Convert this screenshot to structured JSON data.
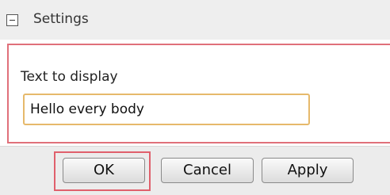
{
  "header": {
    "title": "Settings",
    "collapse_icon": "collapse-minus-icon"
  },
  "form": {
    "label": "Text to display",
    "value": "Hello every body"
  },
  "buttons": {
    "ok": "OK",
    "cancel": "Cancel",
    "apply": "Apply"
  },
  "colors": {
    "highlight": "#e0606c",
    "field_border": "#e6b96b"
  }
}
